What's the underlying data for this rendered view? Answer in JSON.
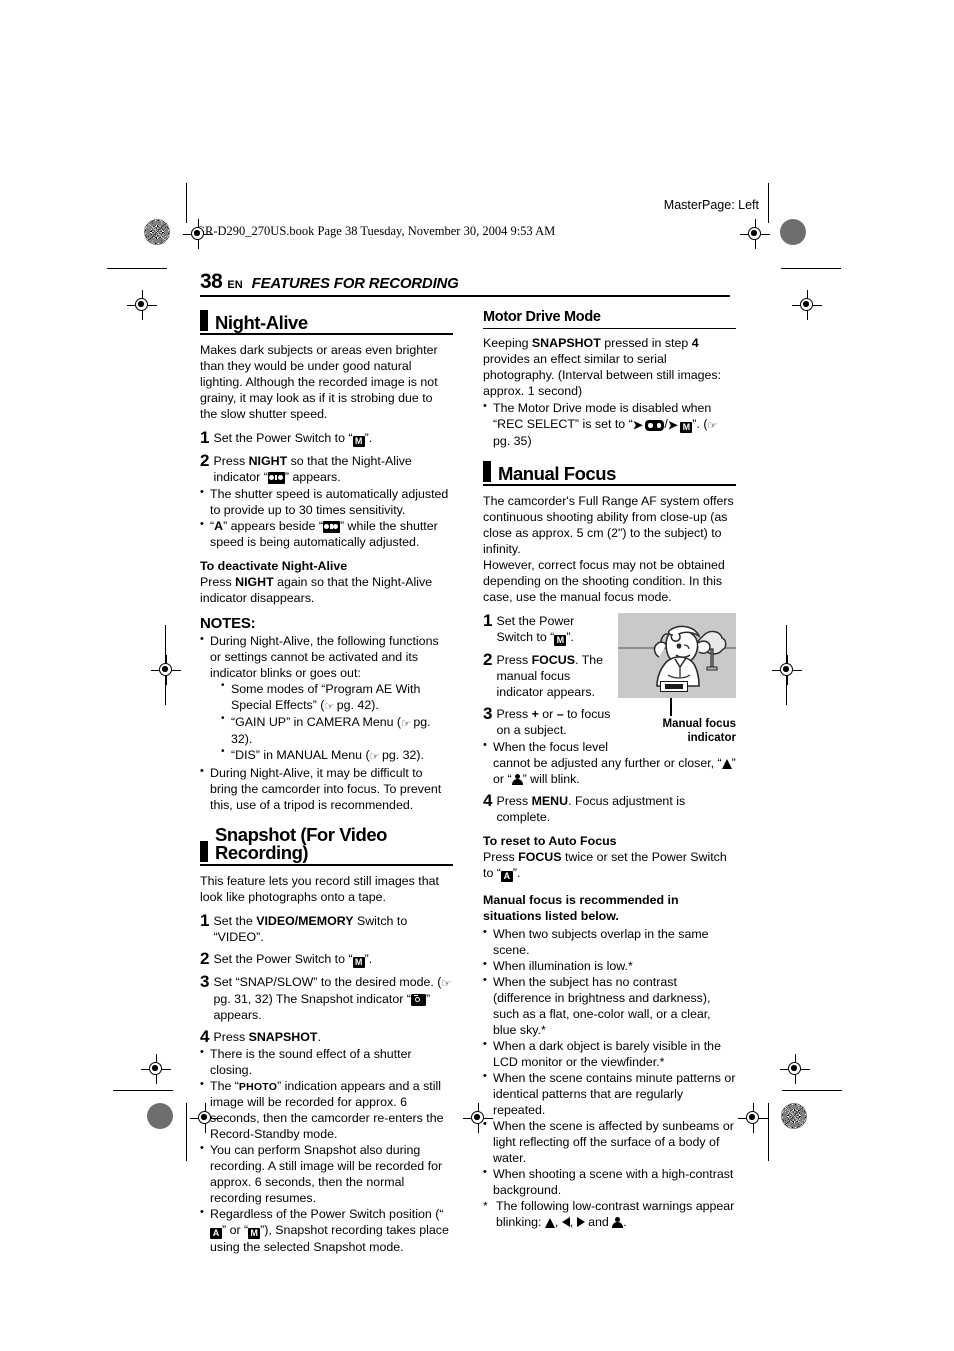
{
  "header": {
    "masterpage": "MasterPage: Left",
    "bookline": "GR-D290_270US.book  Page 38  Tuesday, November 30, 2004  9:53 AM",
    "page_number": "38",
    "lang_code": "EN",
    "chapter_title": "FEATURES FOR RECORDING"
  },
  "left_column": {
    "night_alive": {
      "heading": "Night-Alive",
      "intro": "Makes dark subjects or areas even brighter than they would be under good natural lighting. Although the recorded image is not grainy, it may look as if it is strobing due to the slow shutter speed.",
      "step1_num": "1",
      "step1_a": "Set the Power Switch to “",
      "step1_icon": "power-switch-m-icon",
      "step1_b": "”.",
      "step2_num": "2",
      "step2_a": "Press ",
      "step2_bold": "NIGHT",
      "step2_b": " so that the Night-Alive indicator “",
      "step2_icon": "night-alive-icon",
      "step2_c": "” appears.",
      "bullet1": "The shutter speed is automatically adjusted to provide up to 30 times sensitivity.",
      "bullet2_a": "“",
      "bullet2_bold": "A",
      "bullet2_b": "” appears beside “",
      "bullet2_icon": "night-alive-icon",
      "bullet2_c": "” while the shutter speed is being automatically adjusted.",
      "deactivate_head": "To deactivate Night-Alive",
      "deactivate_a": "Press ",
      "deactivate_bold": "NIGHT",
      "deactivate_b": " again so that the Night-Alive indicator disappears.",
      "notes_head": "NOTES:",
      "note1": "During Night-Alive, the following functions or settings cannot be activated and its indicator blinks or goes out:",
      "note1_sub1_a": "Some modes of “Program AE With Special Effects” (",
      "note1_sub1_ref": "pg. 42).",
      "note1_sub2_a": "“GAIN UP” in CAMERA Menu (",
      "note1_sub2_ref": "pg. 32).",
      "note1_sub3_a": "“DIS” in MANUAL Menu (",
      "note1_sub3_ref": "pg. 32).",
      "note2": "During Night-Alive, it may be difficult to bring the camcorder into focus. To prevent this, use of a tripod is recommended."
    },
    "snapshot": {
      "heading": "Snapshot (For Video Recording)",
      "intro": "This feature lets you record still images that look like photographs onto a tape.",
      "step1_num": "1",
      "step1_a": "Set the ",
      "step1_bold": "VIDEO/MEMORY",
      "step1_b": " Switch to “VIDEO”.",
      "step2_num": "2",
      "step2_a": "Set the Power Switch to “",
      "step2_icon": "power-switch-m-icon",
      "step2_b": "”.",
      "step3_num": "3",
      "step3_a": "Set “SNAP/SLOW” to the desired mode. (",
      "step3_ref": "pg. 31, 32) The Snapshot indicator “",
      "step3_icon": "snapshot-camera-icon",
      "step3_b": "” appears.",
      "step4_num": "4",
      "step4_a": "Press ",
      "step4_bold": "SNAPSHOT",
      "step4_b": ".",
      "bullet1": "There is the sound effect of a shutter closing.",
      "bullet2_a": "The “",
      "bullet2_photo": "PHOTO",
      "bullet2_b": "” indication appears and a still image will be recorded for approx. 6 seconds, then the camcorder re-enters the Record-Standby mode.",
      "bullet3": "You can perform Snapshot also during recording. A still image will be recorded for approx. 6 seconds, then the normal recording resumes.",
      "bullet4_a": "Regardless of the Power Switch position (“",
      "bullet4_icon_a": "power-switch-a-icon",
      "bullet4_b": "” or “",
      "bullet4_icon_m": "power-switch-m-icon",
      "bullet4_c": "”), Snapshot recording takes place using the selected Snapshot mode."
    }
  },
  "right_column": {
    "motor_drive": {
      "heading": "Motor Drive Mode",
      "intro_a": "Keeping ",
      "intro_bold1": "SNAPSHOT",
      "intro_b": " pressed in step ",
      "intro_bold2": "4",
      "intro_c": " provides an effect similar to serial photography. (Interval between still images: approx. 1 second)",
      "bullet1_a": "The Motor Drive mode is disabled when “REC SELECT” is set to “",
      "bullet1_icon1": "arrow-right-icon",
      "bullet1_icon2": "tape-icon",
      "bullet1_sep": "/",
      "bullet1_icon3": "arrow-right-icon",
      "bullet1_icon4": "memory-card-m-icon",
      "bullet1_b": "”. (",
      "bullet1_ref": "pg. 35)"
    },
    "manual_focus": {
      "heading": "Manual Focus",
      "intro": "The camcorder's Full Range AF system offers continuous shooting ability from close-up (as close as approx. 5 cm (2\") to the subject) to infinity.\nHowever, correct focus may not be obtained depending on the shooting condition. In this case, use the manual focus mode.",
      "step1_num": "1",
      "step1_a": "Set the Power Switch to “",
      "step1_icon": "power-switch-m-icon",
      "step1_b": "”.",
      "step2_num": "2",
      "step2_a": "Press ",
      "step2_bold": "FOCUS",
      "step2_b": ". The manual focus indicator appears.",
      "step3_num": "3",
      "step3_a": "Press ",
      "step3_bold": "+",
      "step3_b": " or ",
      "step3_bold2": "–",
      "step3_c": " to focus on a subject.",
      "step3_bullet_a": "When the focus level cannot be adjusted any further or closer, “",
      "step3_bullet_icon1": "mountain-far-focus-icon",
      "step3_bullet_b": "” or “",
      "step3_bullet_icon2": "person-near-focus-icon",
      "step3_bullet_c": "” will blink.",
      "step4_num": "4",
      "step4_a": "Press ",
      "step4_bold": "MENU",
      "step4_b": ". Focus adjustment is complete.",
      "figure_caption": "Manual focus indicator",
      "figure_name": "manual-focus-illustration",
      "reset_head": "To reset to Auto Focus",
      "reset_a": "Press ",
      "reset_bold": "FOCUS",
      "reset_b": " twice or set the Power Switch to “",
      "reset_icon": "power-switch-a-icon",
      "reset_c": "”.",
      "recommend_head": "Manual focus is recommended in situations listed below.",
      "rec_b1": "When two subjects overlap in the same scene.",
      "rec_b2": "When illumination is low.*",
      "rec_b3": "When the subject has no contrast (difference in brightness and darkness), such as a flat, one-color wall, or a clear, blue sky.*",
      "rec_b4": "When a dark object is barely visible in the LCD monitor or the viewfinder.*",
      "rec_b5": "When the scene contains minute patterns or identical patterns that are regularly repeated.",
      "rec_b6": "When the scene is affected by sunbeams or light reflecting off the surface of a body of water.",
      "rec_b7": "When shooting a scene with a high-contrast background.",
      "footnote_star": "*",
      "footnote_a": "The following low-contrast warnings appear blinking: ",
      "footnote_icon1": "mountain-far-focus-icon",
      "footnote_sep1": ", ",
      "footnote_icon2": "triangle-left-icon",
      "footnote_sep2": ", ",
      "footnote_icon3": "triangle-right-icon",
      "footnote_sep3": " and ",
      "footnote_icon4": "person-near-focus-icon",
      "footnote_end": "."
    }
  },
  "colors": {
    "ink": "#000000",
    "figure_bg": "#c9c9c9",
    "figure_horizon": "#8d8d8d",
    "reg_dot_gray": "#6e6e6e"
  }
}
